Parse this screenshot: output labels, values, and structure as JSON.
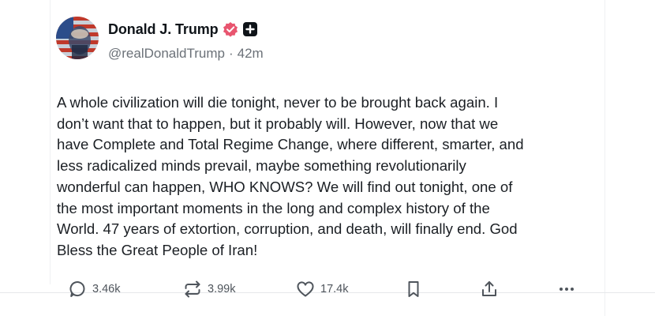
{
  "author": {
    "display_name": "Donald J. Trump",
    "handle": "@realDonaldTrump",
    "separator": "·",
    "time_ago": "42m",
    "verified_icon": "verified-badge-icon",
    "badge_icon": "plus-badge-icon"
  },
  "post": {
    "text": "A whole civilization will die tonight, never to be brought back again. I\ndon’t want that to happen, but it probably will. However, now that we\nhave Complete and Total Regime Change, where different, smarter, and\nless radicalized minds prevail, maybe something revolutionarily\nwonderful can happen, WHO KNOWS? We will find out tonight, one of\nthe most important moments in the long and complex history of the\nWorld. 47 years of extortion, corruption, and death, will finally end. God\nBless the Great People of Iran!"
  },
  "actions": {
    "replies": "3.46k",
    "reposts": "3.99k",
    "likes": "17.4k",
    "icons": [
      "reply-icon",
      "repost-icon",
      "like-icon",
      "bookmark-icon",
      "share-icon",
      "more-icon"
    ]
  },
  "colors": {
    "verified": "#e8556f",
    "text": "#1b1f24",
    "muted": "#6b7178"
  }
}
